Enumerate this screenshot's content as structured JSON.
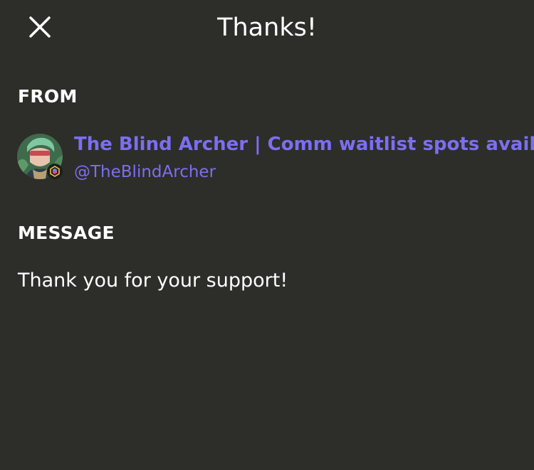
{
  "header": {
    "title": "Thanks!",
    "close_icon": "close-icon"
  },
  "from": {
    "label": "FROM",
    "sender": {
      "name": "The Blind Archer | Comm waitlist spots availa",
      "handle": "@TheBlindArcher",
      "avatar_icon": "avatar",
      "badge_icon": "hexagon-badge-icon"
    }
  },
  "message": {
    "label": "MESSAGE",
    "body": "Thank you for your support!"
  },
  "colors": {
    "background": "#2d2d2a",
    "text": "#ffffff",
    "accent": "#7b6ff0"
  }
}
